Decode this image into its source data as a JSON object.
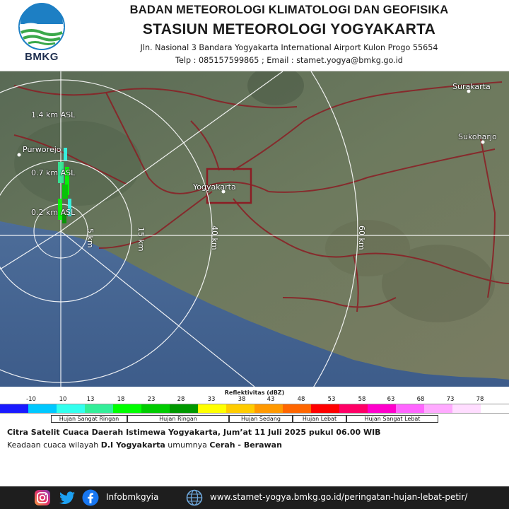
{
  "header": {
    "logo_text": "BMKG",
    "agency": "BADAN METEOROLOGI KLIMATOLOGI DAN GEOFISIKA",
    "station": "STASIUN METEOROLOGI YOGYAKARTA",
    "address": "Jln. Nasional 3 Bandara Yogyakarta International Airport Kulon Progo 55654",
    "contact": "Telp : 085157599865 ;  Email : stamet.yogya@bmkg.go.id"
  },
  "map": {
    "places": [
      "Surakarta",
      "Sukoharjo",
      "Purworejo",
      "Yogyakarta"
    ],
    "altitudes": [
      "1.4 km ASL",
      "0.7 km ASL",
      "0.2 km ASL"
    ],
    "ranges": [
      "5 km",
      "15 km",
      "40 km",
      "60 km"
    ]
  },
  "legend": {
    "title": "Reflektivitas (dBZ)",
    "ticks": [
      "-10",
      "10",
      "13",
      "18",
      "23",
      "28",
      "33",
      "38",
      "43",
      "48",
      "53",
      "58",
      "63",
      "68",
      "73",
      "78"
    ],
    "colors": [
      "#1a1aff",
      "#00c8ff",
      "#33ffee",
      "#33ee99",
      "#00ff00",
      "#00cc00",
      "#009900",
      "#ffff00",
      "#ffcc00",
      "#ff9900",
      "#ff6600",
      "#ff0000",
      "#ff0066",
      "#ff00cc",
      "#ff66ff",
      "#ffaaff",
      "#ffddff",
      "#ffffff"
    ],
    "categories": [
      "Hujan Sangat Ringan",
      "Hujan Ringan",
      "Hujan Sedang",
      "Hujan Lebat",
      "Hujan Sangat Lebat"
    ]
  },
  "caption": {
    "line1": "Citra Satelit Cuaca Daerah Istimewa Yogyakarta, Jum’at 11 Juli 2025 pukul 06.00 WIB",
    "line2_prefix": "Keadaan cuaca wilayah ",
    "line2_region": "D.I Yogyakarta",
    "line2_mid": " umumnya ",
    "line2_condition": "Cerah - Berawan"
  },
  "footer": {
    "social_handle": "Infobmkgyia",
    "website": "www.stamet-yogya.bmkg.go.id/peringatan-hujan-lebat-petir/",
    "icons": [
      "instagram-icon",
      "twitter-icon",
      "facebook-icon",
      "globe-icon"
    ]
  }
}
